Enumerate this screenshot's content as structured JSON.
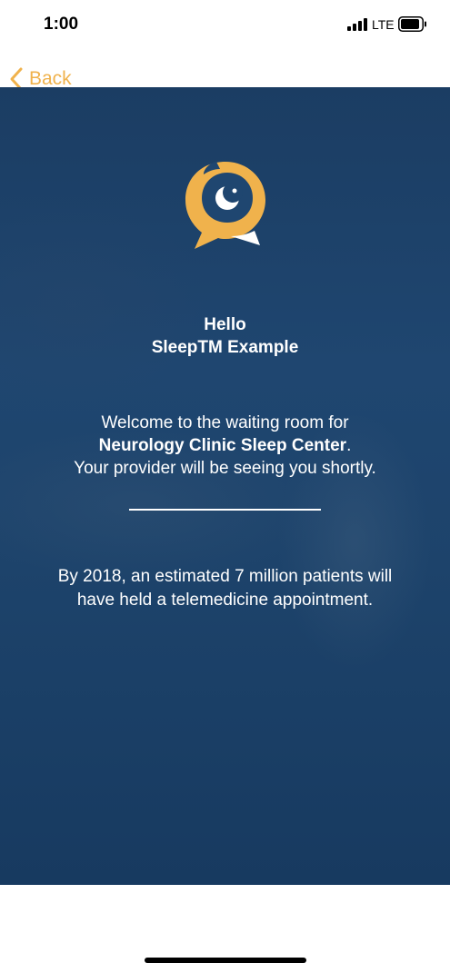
{
  "status_bar": {
    "time": "1:00",
    "network": "LTE",
    "signal_icon": "cellular-signal-icon",
    "battery_icon": "battery-icon"
  },
  "nav": {
    "back_label": "Back",
    "back_icon": "chevron-left-icon",
    "accent_color": "#f0b24c"
  },
  "logo": {
    "icon": "speech-bubble-moon-logo",
    "color": "#f0b24c"
  },
  "greeting": {
    "line1": "Hello",
    "line2": "SleepTM Example"
  },
  "welcome": {
    "line1": "Welcome to the waiting room for",
    "clinic": "Neurology Clinic Sleep Center",
    "period": ".",
    "line3": "Your provider will be seeing you shortly."
  },
  "fact": {
    "line1": "By 2018, an estimated 7 million patients will",
    "line2": "have held a telemedicine appointment."
  },
  "colors": {
    "background": "#1f4670",
    "text": "#ffffff"
  }
}
